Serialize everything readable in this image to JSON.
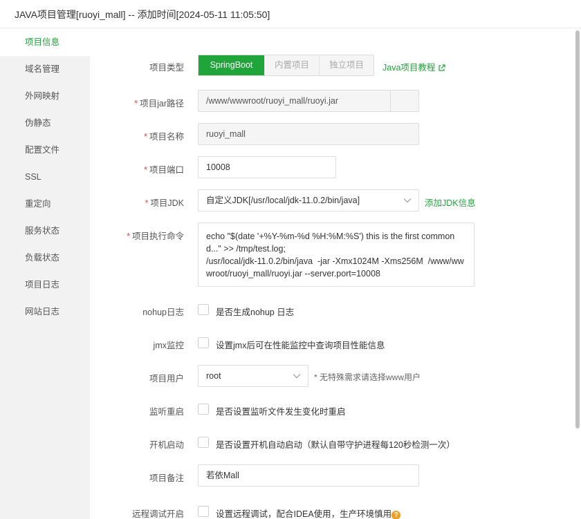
{
  "dialog": {
    "title": "JAVA项目管理[ruoyi_mall] -- 添加时间[2024-05-11 11:05:50]"
  },
  "sidebar": {
    "items": [
      {
        "label": "项目信息",
        "active": true
      },
      {
        "label": "域名管理"
      },
      {
        "label": "外网映射"
      },
      {
        "label": "伪静态"
      },
      {
        "label": "配置文件"
      },
      {
        "label": "SSL"
      },
      {
        "label": "重定向"
      },
      {
        "label": "服务状态"
      },
      {
        "label": "负载状态"
      },
      {
        "label": "项目日志"
      },
      {
        "label": "网站日志"
      }
    ]
  },
  "form": {
    "project_type": {
      "label": "项目类型",
      "options": [
        "SpringBoot",
        "内置项目",
        "独立项目"
      ],
      "selected": "SpringBoot",
      "tutorial_link": "Java项目教程"
    },
    "jar_path": {
      "required": "*",
      "label": "项目jar路径",
      "value": "/www/wwwroot/ruoyi_mall/ruoyi.jar"
    },
    "project_name": {
      "required": "*",
      "label": "项目名称",
      "value": "ruoyi_mall"
    },
    "project_port": {
      "required": "*",
      "label": "项目端口",
      "value": "10008"
    },
    "project_jdk": {
      "required": "*",
      "label": "项目JDK",
      "value": "自定义JDK[/usr/local/jdk-11.0.2/bin/java]",
      "add_link": "添加JDK信息"
    },
    "exec_command": {
      "required": "*",
      "label": "项目执行命令",
      "value": "echo \"$(date '+%Y-%m-%d %H:%M:%S') this is the first commond...\" >> /tmp/test.log;\n/usr/local/jdk-11.0.2/bin/java  -jar -Xmx1024M -Xms256M  /www/wwwroot/ruoyi_mall/ruoyi.jar --server.port=10008"
    },
    "nohup_log": {
      "label": "nohup日志",
      "text": "是否生成nohup 日志",
      "checked": false
    },
    "jmx_monitor": {
      "label": "jmx监控",
      "text": "设置jmx后可在性能监控中查询项目性能信息",
      "checked": false
    },
    "project_user": {
      "label": "项目用户",
      "value": "root",
      "hint": "* 无特殊需求请选择www用户"
    },
    "watch_restart": {
      "label": "监听重启",
      "text": "是否设置监听文件发生变化时重启",
      "checked": false
    },
    "boot_start": {
      "label": "开机启动",
      "text": "是否设置开机自动启动（默认自带守护进程每120秒检测一次）",
      "checked": false
    },
    "project_note": {
      "label": "项目备注",
      "value": "若依Mall"
    },
    "remote_debug": {
      "label": "远程调试开启",
      "text": "设置远程调试，配合IDEA使用，生产环境慎用",
      "checked": false
    }
  },
  "colors": {
    "accent": "#20a53a",
    "required": "#f04545",
    "help_icon": "#f0a020"
  }
}
